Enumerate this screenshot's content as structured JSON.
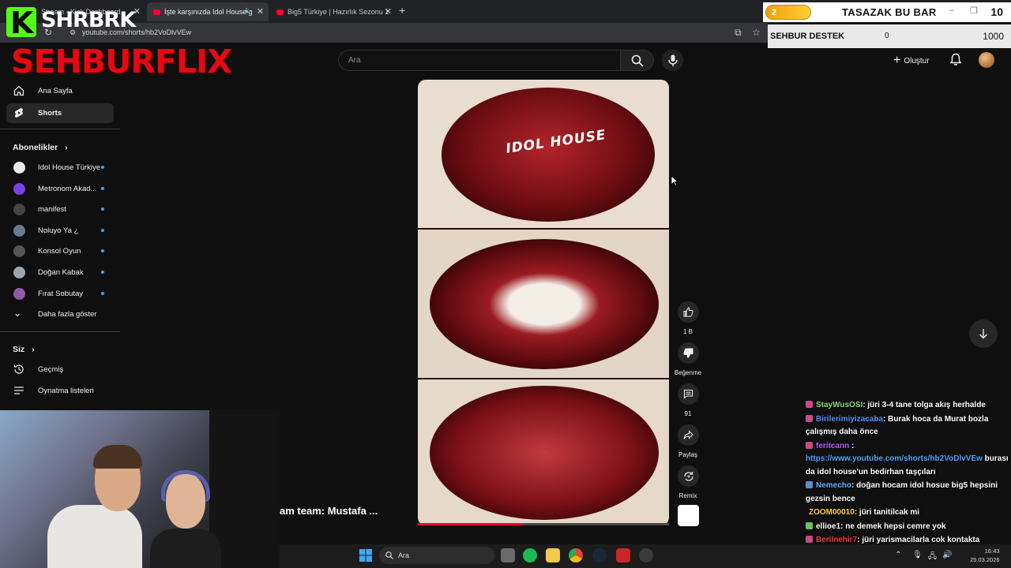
{
  "browser": {
    "tabs": [
      {
        "title": "Stream - Kick Dashboard"
      },
      {
        "title": "İşte karşınızda Idol House g"
      },
      {
        "title": "Big5 Türkiye | Hazırlık Sezonu 1"
      }
    ],
    "url": "youtube.com/shorts/hb2VoDlvVEw"
  },
  "stream_overlay": {
    "brand": "SHRBRK",
    "logo_text": "SEHBURFLIX",
    "bar_title": "TASAZAK BU BAR",
    "bar_level": "2",
    "bar_count": "10",
    "destek_title": "SEHBUR DESTEK",
    "destek_current": "0",
    "destek_goal": "1000",
    "webcam_caption": "am team: Mustafa ..."
  },
  "youtube": {
    "search_placeholder": "Ara",
    "create_label": "Oluştur",
    "sidebar": {
      "nav": [
        {
          "label": "Ana Sayfa"
        },
        {
          "label": "Shorts"
        }
      ],
      "subscriptions_title": "Abonelikler",
      "subscriptions": [
        {
          "label": "Idol House Türkiye",
          "color": "#e9e9e9"
        },
        {
          "label": "Metronom Akad...",
          "color": "#7b3fe4"
        },
        {
          "label": "manifest",
          "color": "#444444"
        },
        {
          "label": "Noluyo Ya ¿",
          "color": "#6a7b8c"
        },
        {
          "label": "Konsol Oyun",
          "color": "#555555"
        },
        {
          "label": "Doğan Kabak",
          "color": "#9aa7b5"
        },
        {
          "label": "Fırat Sobutay",
          "color": "#8c5aa8"
        }
      ],
      "show_more": "Daha fazla göster",
      "you_title": "Siz",
      "you_items": [
        {
          "label": "Geçmiş"
        },
        {
          "label": "Oynatma listeleri"
        }
      ]
    },
    "short": {
      "logo_text": "IDOL HOUSE",
      "progress": 0.42,
      "actions": {
        "like_count": "1 B",
        "dislike_label": "Beğenme",
        "comment_count": "91",
        "share_label": "Paylaş",
        "remix_label": "Remix"
      }
    }
  },
  "chat": [
    {
      "user": "StayWusOSI",
      "user_color": "#7fe06a",
      "badge_color": "#c94a8a",
      "text": ": jüri 3-4 tane tolga akış herhalde"
    },
    {
      "user": "Birilerimiyizacaba",
      "user_color": "#4f93ff",
      "badge_color": "#c94a8a",
      "text": ": Burak hoca da Murat bozla çalışmış daha önce"
    },
    {
      "user": "feritcann",
      "user_color": "#b45cff",
      "badge_color": "#c94a8a",
      "text": " :",
      "link": "https://www.youtube.com/shorts/hb2VoDlvVEw",
      "text2": " burası da idol house'un bedirhan taşçıları"
    },
    {
      "user": "Nemecho",
      "user_color": "#5fb3ff",
      "badge_color": "#5a8fd0",
      "text": ": doğan hocam idol hosue big5 hepsini gezsin bence"
    },
    {
      "user": "ZOOM00010",
      "user_color": "#ffd23f",
      "badge_color": "",
      "text": ": jüri tanitilcak mi"
    },
    {
      "user": "ellioe1",
      "user_color": "#ffffff",
      "badge_color": "#6cc05a",
      "text": ": ne demek hepsi cemre yok"
    },
    {
      "user": "Berilnehir7",
      "user_color": "#ff3b3b",
      "badge_color": "#c94a8a",
      "text": ": jüri yarismacilarla cok kontakta iletişimde olmayacak"
    }
  ],
  "taskbar": {
    "search_placeholder": "Ara",
    "time": "16:43",
    "date": "25.03.2026"
  }
}
